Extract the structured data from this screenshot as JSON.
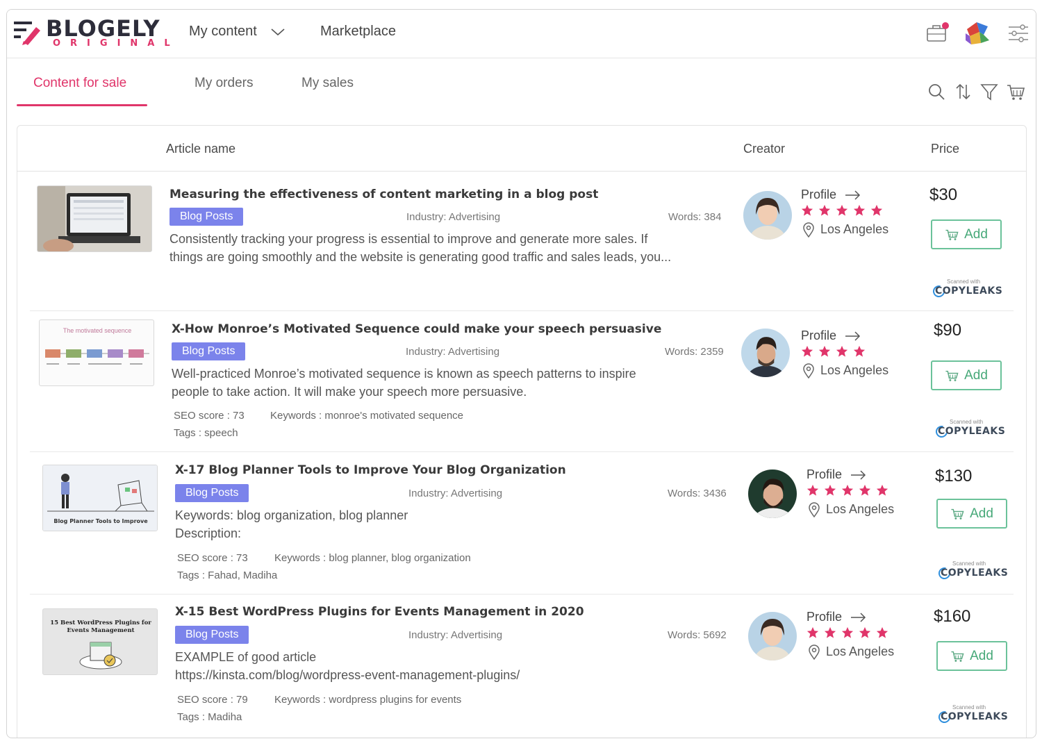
{
  "brand": {
    "name": "BLOGELY",
    "sub": "ORIGINAL",
    "accent": "#e0356a"
  },
  "nav": {
    "my_content": "My content",
    "marketplace": "Marketplace"
  },
  "header_icons": [
    "briefcase-notification-icon",
    "user-avatar",
    "settings-sliders-icon"
  ],
  "tabs": {
    "content_for_sale": "Content for sale",
    "my_orders": "My orders",
    "my_sales": "My sales"
  },
  "toolbar_icons": [
    "search-icon",
    "sort-icon",
    "filter-icon",
    "cart-icon"
  ],
  "columns": {
    "article": "Article name",
    "creator": "Creator",
    "price": "Price"
  },
  "rows": [
    {
      "title": "Measuring the effectiveness of content marketing in a blog post",
      "category": "Blog Posts",
      "industry": "Industry: Advertising",
      "words": "Words: 384",
      "desc1": "Consistently tracking your progress is essential to improve and generate more sales. If",
      "desc2": "things are going smoothly and the website is generating good traffic and sales leads, you...",
      "profile": "Profile",
      "rating": 5,
      "location": "Los Angeles",
      "price": "$30",
      "add": "Add",
      "scanned": "Scanned with",
      "copyleaks": "COPYLEAKS"
    },
    {
      "title": "X-How Monroe’s Motivated Sequence could make your speech persuasive",
      "category": "Blog Posts",
      "industry": "Industry: Advertising",
      "words": "Words: 2359",
      "desc1": "Well-practiced Monroe’s motivated sequence is known as speech patterns to inspire",
      "desc2": "people to take action. It will make your speech more persuasive.",
      "seo": "SEO score : 73",
      "keywords": "Keywords : monroe's motivated sequence",
      "tags": "Tags : speech",
      "thumb_text": "The motivated sequence",
      "profile": "Profile",
      "rating": 4,
      "location": "Los Angeles",
      "price": "$90",
      "add": "Add",
      "scanned": "Scanned with",
      "copyleaks": "COPYLEAKS"
    },
    {
      "title": "X-17 Blog Planner Tools to Improve Your Blog Organization",
      "category": "Blog Posts",
      "industry": "Industry: Advertising",
      "words": "Words: 3436",
      "desc1": "Keywords: blog organization, blog planner",
      "desc2": "Description:",
      "seo": "SEO score : 73",
      "keywords": "Keywords : blog planner, blog organization",
      "tags": "Tags : Fahad, Madiha",
      "thumb_text": "Blog Planner Tools to Improve",
      "profile": "Profile",
      "rating": 5,
      "location": "Los Angeles",
      "price": "$130",
      "add": "Add",
      "scanned": "Scanned with",
      "copyleaks": "COPYLEAKS"
    },
    {
      "title": "X-15 Best WordPress Plugins for Events Management in 2020",
      "category": "Blog Posts",
      "industry": "Industry: Advertising",
      "words": "Words: 5692",
      "desc1": "EXAMPLE of good article",
      "desc2": "https://kinsta.com/blog/wordpress-event-management-plugins/",
      "seo": "SEO score : 79",
      "keywords": "Keywords : wordpress plugins for events",
      "tags": "Tags : Madiha",
      "thumb_text": "15 Best WordPress Plugins for Events Management",
      "profile": "Profile",
      "rating": 5,
      "location": "Los Angeles",
      "price": "$160",
      "add": "Add",
      "scanned": "Scanned with",
      "copyleaks": "COPYLEAKS"
    }
  ]
}
